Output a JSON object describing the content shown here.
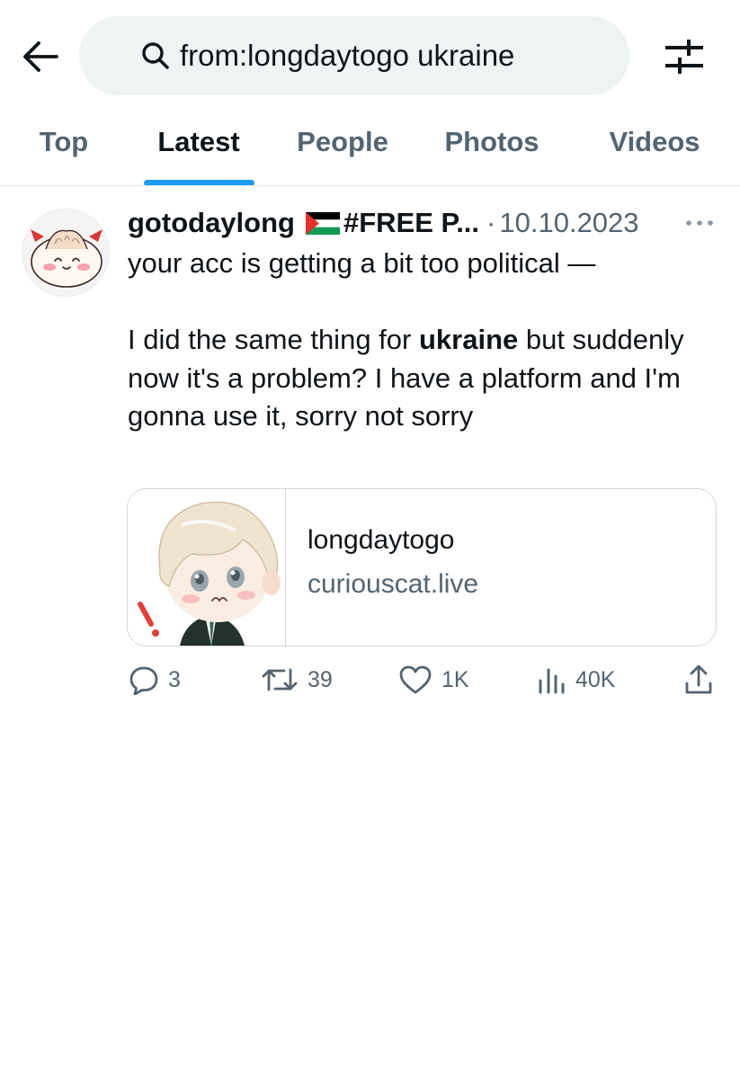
{
  "search": {
    "value": "from:longdaytogo ukraine"
  },
  "icons": {
    "back": "arrow-left-icon",
    "search": "magnifier-icon",
    "filter": "sliders-icon",
    "more": "more-horizontal-icon",
    "reply": "speech-bubble-icon",
    "retweet": "retweet-icon",
    "like": "heart-icon",
    "views": "bar-chart-icon",
    "share": "share-upload-icon"
  },
  "tabs": [
    {
      "label": "Top",
      "active": false
    },
    {
      "label": "Latest",
      "active": true
    },
    {
      "label": "People",
      "active": false
    },
    {
      "label": "Photos",
      "active": false
    },
    {
      "label": "Videos",
      "active": false
    }
  ],
  "tweet": {
    "display_name": "gotodaylong",
    "display_name_rest": "#FREE P...",
    "separator": "·",
    "date": "10.10.2023",
    "text": {
      "line1": "your acc is getting a bit too political —",
      "para2_before": "I did the same thing for ",
      "para2_bold": "ukraine",
      "para2_after": " but suddenly now it's a problem? I have a platform and I'm gonna use it, sorry not sorry"
    },
    "card": {
      "title": "longdaytogo",
      "domain": "curiouscat.live"
    },
    "stats": {
      "replies": "3",
      "retweets": "39",
      "likes": "1K",
      "views": "40K"
    }
  },
  "colors": {
    "accent": "#1d9bf0",
    "text_primary": "#0f1419",
    "text_secondary": "#536471",
    "search_bg": "#eff3f4",
    "border": "#cfd9de"
  }
}
